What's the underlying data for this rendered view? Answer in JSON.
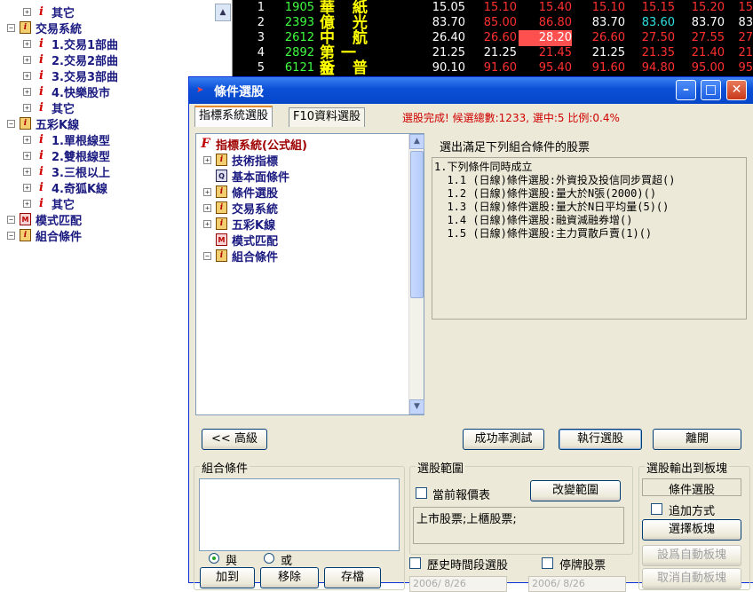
{
  "background_tree": {
    "items": [
      {
        "label": "其它",
        "icon": "i-icon",
        "level": 2
      },
      {
        "label": "交易系統",
        "icon": "book-icon",
        "level": 1
      },
      {
        "label": "1.交易1部曲",
        "icon": "i-icon",
        "level": 2
      },
      {
        "label": "2.交易2部曲",
        "icon": "i-icon",
        "level": 2
      },
      {
        "label": "3.交易3部曲",
        "icon": "i-icon",
        "level": 2
      },
      {
        "label": "4.快樂股市",
        "icon": "i-icon",
        "level": 2
      },
      {
        "label": "其它",
        "icon": "i-icon",
        "level": 2
      },
      {
        "label": "五彩K線",
        "icon": "book-icon",
        "level": 1
      },
      {
        "label": "1.單根線型",
        "icon": "i-icon",
        "level": 2
      },
      {
        "label": "2.雙根線型",
        "icon": "i-icon",
        "level": 2
      },
      {
        "label": "3.三根以上",
        "icon": "i-icon",
        "level": 2
      },
      {
        "label": "4.奇狐K線",
        "icon": "i-icon",
        "level": 2
      },
      {
        "label": "其它",
        "icon": "i-icon",
        "level": 2
      },
      {
        "label": "模式匹配",
        "icon": "m-icon",
        "level": 1
      },
      {
        "label": "組合條件",
        "icon": "book-icon",
        "level": 0
      }
    ]
  },
  "quotes": {
    "rows": [
      {
        "idx": "1",
        "code": "1905",
        "name": "華 紙",
        "cells": [
          "15.05",
          "15.10",
          "15.40",
          "15.10",
          "15.15",
          "15.20",
          "15"
        ],
        "colors": [
          "#ffffff",
          "#ff3030",
          "#ff3030",
          "#ff3030",
          "#ff3030",
          "#ff3030",
          "#ff3030"
        ]
      },
      {
        "idx": "2",
        "code": "2393",
        "name": "億 光",
        "cells": [
          "83.70",
          "85.00",
          "86.80",
          "83.70",
          "83.60",
          "83.70",
          "83"
        ],
        "colors": [
          "#ffffff",
          "#ff3030",
          "#ff3030",
          "#ffffff",
          "#30e0e0",
          "#ffffff",
          "#ffffff"
        ]
      },
      {
        "idx": "3",
        "code": "2612",
        "name": "中 航",
        "cells": [
          "26.40",
          "26.60",
          "28.20",
          "26.60",
          "27.50",
          "27.55",
          "27"
        ],
        "colors": [
          "#ffffff",
          "#ff3030",
          "#ffffff",
          "#ff3030",
          "#ff3030",
          "#ff3030",
          "#ff3030"
        ]
      },
      {
        "idx": "4",
        "code": "2892",
        "name": "第一金",
        "cells": [
          "21.25",
          "21.25",
          "21.45",
          "21.25",
          "21.35",
          "21.40",
          "21"
        ],
        "colors": [
          "#ffffff",
          "#ffffff",
          "#ff3030",
          "#ffffff",
          "#ff3030",
          "#ff3030",
          "#ff3030"
        ]
      },
      {
        "idx": "5",
        "code": "6121",
        "name": "新 普",
        "cells": [
          "90.10",
          "91.60",
          "95.40",
          "91.60",
          "94.80",
          "95.00",
          "95"
        ],
        "colors": [
          "#ffffff",
          "#ff3030",
          "#ff3030",
          "#ff3030",
          "#ff3030",
          "#ff3030",
          "#ff3030"
        ]
      }
    ],
    "highlight_color": "#ff5050"
  },
  "dialog": {
    "title": "條件選股",
    "tabs": [
      "指標系統選股",
      "F10資料選股"
    ],
    "status": "選股完成! 候選總數:1233, 選中:5 比例:0.4%",
    "tree": [
      {
        "label": "指標系統(公式組)",
        "icon": "f-icon",
        "expander": ""
      },
      {
        "label": "技術指標",
        "icon": "book-icon",
        "expander": "+"
      },
      {
        "label": "基本面條件",
        "icon": "q-icon",
        "expander": ""
      },
      {
        "label": "條件選股",
        "icon": "book-icon",
        "expander": "+"
      },
      {
        "label": "交易系統",
        "icon": "book-icon",
        "expander": "+"
      },
      {
        "label": "五彩K線",
        "icon": "book-icon",
        "expander": "+"
      },
      {
        "label": "模式匹配",
        "icon": "m-icon",
        "expander": ""
      },
      {
        "label": "組合條件",
        "icon": "book-icon",
        "expander": "-"
      }
    ],
    "conditions_title": "選出滿足下列組合條件的股票",
    "conditions": [
      "1.下列條件同時成立",
      "  1.1 (日線)條件選股:外資投及投信同步買超()",
      "  1.2 (日線)條件選股:量大於N張(2000)()",
      "  1.3 (日線)條件選股:量大於N日平均量(5)()",
      "  1.4 (日線)條件選股:融資減融券增()",
      "  1.5 (日線)條件選股:主力買散戶賣(1)()"
    ],
    "buttons": {
      "advanced": "<< 高級",
      "success_test": "成功率測試",
      "execute": "執行選股",
      "leave": "離開",
      "add": "加到",
      "remove": "移除",
      "save": "存檔",
      "change_range": "改變範圍",
      "select_block": "選擇板塊",
      "set_auto_block": "設爲自動板塊",
      "cancel_auto_block": "取消自動板塊"
    },
    "combo": {
      "title": "組合條件",
      "and_label": "與",
      "or_label": "或",
      "selected": "and"
    },
    "range": {
      "title": "選股範圍",
      "current_quote_label": "當前報價表",
      "current_quote_checked": false,
      "value": "上市股票;上櫃股票;",
      "history_label": "歷史時間段選股",
      "history_checked": false,
      "suspended_label": "停牌股票",
      "suspended_checked": false,
      "date_from": "2006/ 8/26",
      "date_to": "2006/ 8/26"
    },
    "output": {
      "title": "選股輸出到板塊",
      "value": "條件選股",
      "append_label": "追加方式",
      "append_checked": false
    }
  }
}
